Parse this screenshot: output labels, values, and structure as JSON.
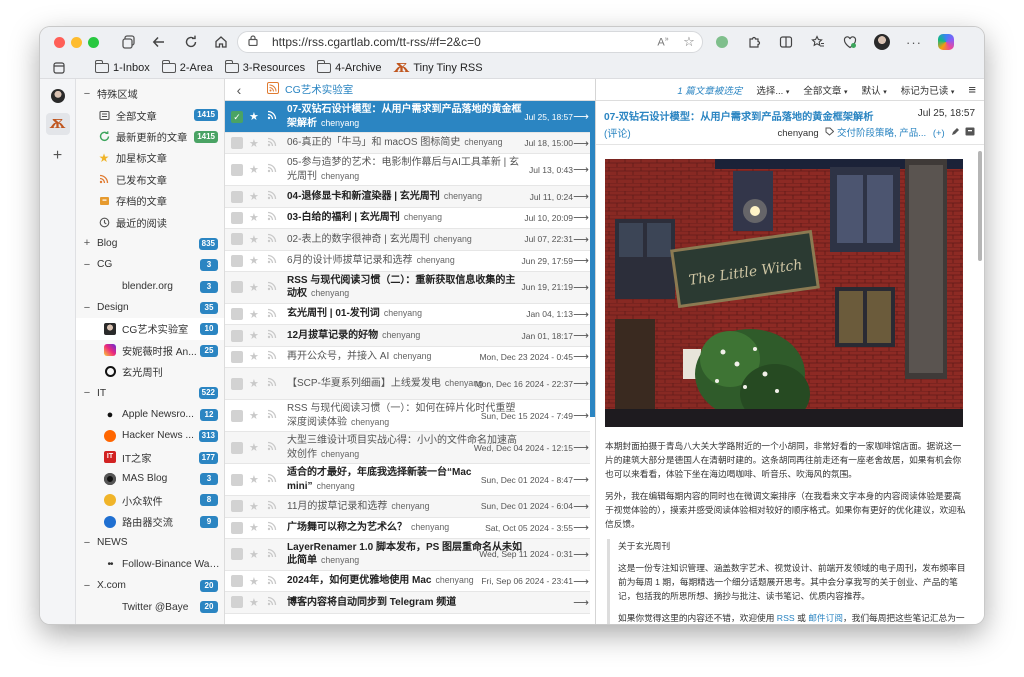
{
  "browser": {
    "url": "https://rss.cgartlab.com/tt-rss/#f=2&c=0",
    "reader_icon_label": "A"
  },
  "bookmarks": [
    {
      "label": "1-Inbox",
      "type": "folder"
    },
    {
      "label": "2-Area",
      "type": "folder"
    },
    {
      "label": "3-Resources",
      "type": "folder"
    },
    {
      "label": "4-Archive",
      "type": "folder"
    },
    {
      "label": "Tiny Tiny RSS",
      "type": "site"
    }
  ],
  "feeds": [
    {
      "kind": "cat",
      "expander": "−",
      "label": "特殊区域"
    },
    {
      "kind": "feed",
      "icon": "all",
      "label": "全部文章",
      "count": "1415",
      "badge": "#2b85c2"
    },
    {
      "kind": "feed",
      "icon": "fresh",
      "label": "最新更新的文章",
      "count": "1415",
      "badge": "#4aa364"
    },
    {
      "kind": "feed",
      "icon": "star",
      "label": "加星标文章"
    },
    {
      "kind": "feed",
      "icon": "rss",
      "label": "已发布文章"
    },
    {
      "kind": "feed",
      "icon": "archive",
      "label": "存档的文章"
    },
    {
      "kind": "feed",
      "icon": "recent",
      "label": "最近的阅读"
    },
    {
      "kind": "cat",
      "expander": "+",
      "label": "Blog",
      "count": "835",
      "badge": "#2b85c2"
    },
    {
      "kind": "cat",
      "expander": "−",
      "label": "CG",
      "count": "3",
      "badge": "#2b85c2"
    },
    {
      "kind": "sub",
      "icon": "none",
      "label": "blender.org",
      "count": "3",
      "badge": "#2b85c2"
    },
    {
      "kind": "cat",
      "expander": "−",
      "label": "Design",
      "count": "35",
      "badge": "#2b85c2"
    },
    {
      "kind": "sub",
      "icon": "avatar",
      "label": "CG艺术实验室",
      "count": "10",
      "badge": "#2b85c2",
      "selected": true
    },
    {
      "kind": "sub",
      "icon": "insta",
      "label": "安妮薇时报 An...",
      "count": "25",
      "badge": "#2b85c2"
    },
    {
      "kind": "sub",
      "icon": "circle",
      "label": "玄光周刊"
    },
    {
      "kind": "cat",
      "expander": "−",
      "label": "IT",
      "count": "522",
      "badge": "#2b85c2"
    },
    {
      "kind": "sub",
      "icon": "apple",
      "label": "Apple Newsro...",
      "count": "12",
      "badge": "#2b85c2"
    },
    {
      "kind": "sub",
      "icon": "hn",
      "label": "Hacker News ...",
      "count": "313",
      "badge": "#2b85c2"
    },
    {
      "kind": "sub",
      "icon": "ithome",
      "label": "IT之家",
      "count": "177",
      "badge": "#2b85c2"
    },
    {
      "kind": "sub",
      "icon": "mas",
      "label": "MAS Blog",
      "count": "3",
      "badge": "#2b85c2"
    },
    {
      "kind": "sub",
      "icon": "sspai",
      "label": "小众软件",
      "count": "8",
      "badge": "#2b85c2"
    },
    {
      "kind": "sub",
      "icon": "router",
      "label": "路由器交流",
      "count": "9",
      "badge": "#2b85c2"
    },
    {
      "kind": "cat",
      "expander": "−",
      "label": "NEWS"
    },
    {
      "kind": "sub",
      "icon": "dots",
      "label": "Follow-Binance Wallet"
    },
    {
      "kind": "cat",
      "expander": "−",
      "label": "X.com",
      "count": "20",
      "badge": "#2b85c2"
    },
    {
      "kind": "sub",
      "icon": "none",
      "label": "Twitter @Baye",
      "count": "20",
      "badge": "#2b85c2"
    }
  ],
  "headlines_toolbar": {
    "back": "‹",
    "feed_title": "CG艺术实验室"
  },
  "headlines": [
    {
      "title": "07-双钻石设计模型：从用户需求到产品落地的黄金框架解析",
      "author": "chenyang",
      "date": "Jul 25, 18:57",
      "selected": true,
      "checked": true,
      "lines": 2
    },
    {
      "title": "06-真正的「牛马」和 macOS 图标简史",
      "author": "chenyang",
      "date": "Jul 18, 15:00",
      "read": true,
      "lines": 1
    },
    {
      "title": "05-参与造梦的艺术：电影制作幕后与AI工具革新 | 玄光周刊",
      "author": "chenyang",
      "date": "Jul 13, 0:43",
      "read": true,
      "lines": 2
    },
    {
      "title": "04-退修显卡和新渲染器 | 玄光周刊",
      "author": "chenyang",
      "date": "Jul 11, 0:24",
      "lines": 1
    },
    {
      "title": "03-白给的福利 | 玄光周刊",
      "author": "chenyang",
      "date": "Jul 10, 20:09",
      "lines": 1
    },
    {
      "title": "02-表上的数字很神奇 | 玄光周刊",
      "author": "chenyang",
      "date": "Jul 07, 22:31",
      "read": true,
      "lines": 1
    },
    {
      "title": "6月的设计师拔草记录和选荐",
      "author": "chenyang",
      "date": "Jun 29, 17:59",
      "read": true,
      "lines": 1
    },
    {
      "title": "RSS 与现代阅读习惯（二）：重新获取信息收集的主动权",
      "author": "chenyang",
      "date": "Jun 19, 21:19",
      "lines": 2
    },
    {
      "title": "玄光周刊 | 01-发刊词",
      "author": "chenyang",
      "date": "Jan 04, 1:13",
      "lines": 1
    },
    {
      "title": "12月拔草记录的好物",
      "author": "chenyang",
      "date": "Jan 01, 18:17",
      "lines": 1
    },
    {
      "title": "再开公众号，并接入 AI",
      "author": "chenyang",
      "date": "Mon, Dec 23 2024 - 0:45",
      "read": true,
      "lines": 1
    },
    {
      "title": "【SCP-华夏系列细画】上线爱发电",
      "author": "chenyang",
      "date": "Mon, Dec 16 2024 - 22:37",
      "read": true,
      "lines": 2
    },
    {
      "title": "RSS 与现代阅读习惯（一）：如何在碎片化时代重塑深度阅读体验",
      "author": "chenyang",
      "date": "Sun, Dec 15 2024 - 7:49",
      "read": true,
      "lines": 2
    },
    {
      "title": "大型三维设计项目实战心得：小小的文件命名加速高效创作",
      "author": "chenyang",
      "date": "Wed, Dec 04 2024 - 12:15",
      "read": true,
      "lines": 2
    },
    {
      "title": "适合的才最好，年底我选择新装一台“Mac mini”",
      "author": "chenyang",
      "date": "Sun, Dec 01 2024 - 8:47",
      "lines": 2
    },
    {
      "title": "11月的拔草记录和选荐",
      "author": "chenyang",
      "date": "Sun, Dec 01 2024 - 6:04",
      "read": true,
      "lines": 1
    },
    {
      "title": "广场舞可以称之为艺术么？",
      "author": "chenyang",
      "date": "Sat, Oct 05 2024 - 3:55",
      "lines": 1
    },
    {
      "title": "LayerRenamer 1.0 脚本发布，PS 图层重命名从未如此简单",
      "author": "chenyang",
      "date": "Wed, Sep 11 2024 - 0:31",
      "lines": 2
    },
    {
      "title": "2024年，如何更优雅地使用 Mac",
      "author": "chenyang",
      "date": "Fri, Sep 06 2024 - 23:41",
      "lines": 1
    },
    {
      "title": "博客内容将自动同步到 Telegram 频道",
      "author": "",
      "date": "",
      "lines": 1
    }
  ],
  "article_toolbar": {
    "selected_count": "1 篇文章被选定",
    "select": "选择...",
    "view_mode": "全部文章",
    "sort": "默认",
    "mark_read": "标记为已读"
  },
  "article": {
    "title": "07-双钻石设计模型：从用户需求到产品落地的黄金框架解析",
    "date": "Jul 25, 18:57",
    "comments": "(评论)",
    "author": "chenyang",
    "tags": "交付阶段策略, 产品...",
    "more_tags": "(+)",
    "paragraph1": "本期封面拍摄于青岛八大关大学路附近的一个小胡同，非常好看的一家咖啡馆店面。据说这一片的建筑大部分是德国人在清朝时建的。这条胡同再往前走还有一座老舍故居，如果有机会你也可以来看看，体验下坐在海边喝咖啡、听音乐、吹海风的氛围。",
    "paragraph2": "另外，我在编辑每期内容的同时也在微调文案排序（在我看来文字本身的内容阅读体验是要高于视觉体验的），摸索并感受阅读体验相对较好的顺序格式。如果你有更好的优化建议，欢迎私信反馈。",
    "quote_title": "关于玄光周刊",
    "quote_body": "这是一份专注知识管理、涵盖数字艺术、视觉设计、前端开发领域的电子周刊，发布频率目前为每周 1 期，每期精选一个细分话题展开思考。其中会分享我写的关于创业、产品的笔记，包括我的所思所想、摘抄与批注、读书笔记、优质内容推荐。",
    "quote_last_prefix": "如果你觉得这里的内容还不错，欢迎使用",
    "quote_link_rss": "RSS",
    "quote_or": "或",
    "quote_link_mail": "邮件订阅",
    "quote_last_suffix": "，我们每周把这些笔记汇总为一封"
  },
  "photo_sign": "The Little Witch"
}
